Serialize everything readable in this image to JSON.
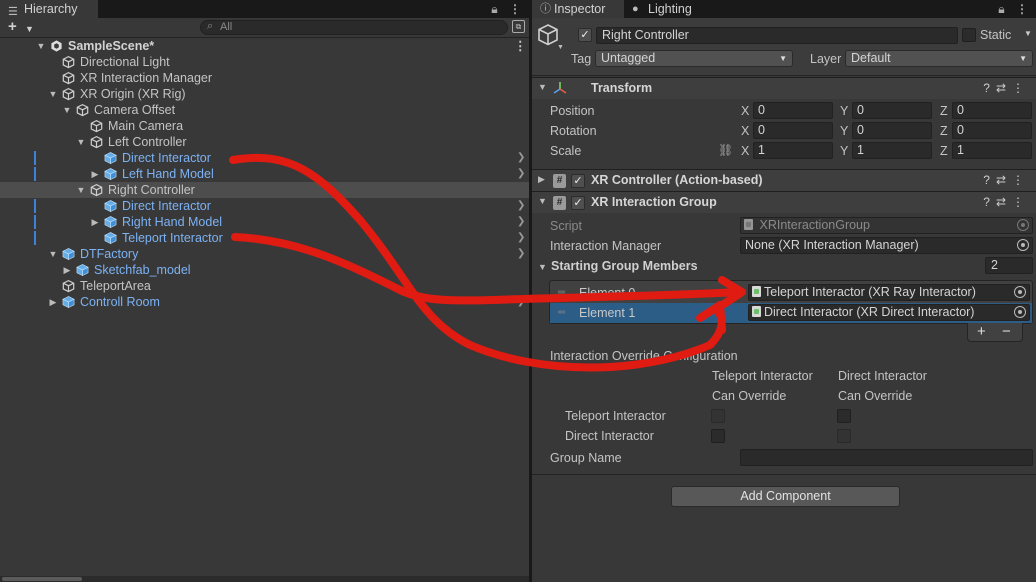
{
  "hierarchy": {
    "tab_label": "Hierarchy",
    "search_placeholder": "All",
    "rows": [
      {
        "label": "SampleScene*",
        "depth": 0,
        "arrow": "down",
        "icon": "unity-logo-icon",
        "style": "scene"
      },
      {
        "label": "Directional Light",
        "depth": 1,
        "arrow": "",
        "icon": "gameobject-icon",
        "style": "normal"
      },
      {
        "label": "XR Interaction Manager",
        "depth": 1,
        "arrow": "",
        "icon": "gameobject-icon",
        "style": "normal"
      },
      {
        "label": "XR Origin (XR Rig)",
        "depth": 1,
        "arrow": "down",
        "icon": "gameobject-icon",
        "style": "normal"
      },
      {
        "label": "Camera Offset",
        "depth": 2,
        "arrow": "down",
        "icon": "gameobject-icon",
        "style": "normal"
      },
      {
        "label": "Main Camera",
        "depth": 3,
        "arrow": "",
        "icon": "gameobject-icon",
        "style": "normal"
      },
      {
        "label": "Left Controller",
        "depth": 3,
        "arrow": "down",
        "icon": "gameobject-icon",
        "style": "normal"
      },
      {
        "label": "Direct Interactor",
        "depth": 4,
        "arrow": "",
        "icon": "prefab-icon",
        "style": "prefab",
        "bar": true,
        "chev": true
      },
      {
        "label": "Left Hand Model",
        "depth": 4,
        "arrow": "right",
        "icon": "prefab-icon",
        "style": "prefab",
        "bar": true,
        "chev": true
      },
      {
        "label": "Right Controller",
        "depth": 3,
        "arrow": "down",
        "icon": "gameobject-icon",
        "style": "normal",
        "selected": true
      },
      {
        "label": "Direct Interactor",
        "depth": 4,
        "arrow": "",
        "icon": "prefab-icon",
        "style": "prefab",
        "bar": true,
        "chev": true
      },
      {
        "label": "Right Hand Model",
        "depth": 4,
        "arrow": "right",
        "icon": "prefab-icon",
        "style": "prefab",
        "bar": true,
        "chev": true
      },
      {
        "label": "Teleport Interactor",
        "depth": 4,
        "arrow": "",
        "icon": "prefab-icon",
        "style": "prefab",
        "bar": true,
        "chev": true
      },
      {
        "label": "DTFactory",
        "depth": 1,
        "arrow": "down",
        "icon": "prefab-icon",
        "style": "prefab",
        "chev": true
      },
      {
        "label": "Sketchfab_model",
        "depth": 2,
        "arrow": "right",
        "icon": "prefab-icon",
        "style": "prefab"
      },
      {
        "label": "TeleportArea",
        "depth": 1,
        "arrow": "",
        "icon": "gameobject-icon",
        "style": "normal"
      },
      {
        "label": "Controll Room",
        "depth": 1,
        "arrow": "right",
        "icon": "prefab-icon",
        "style": "prefab",
        "chev": true
      }
    ]
  },
  "inspector": {
    "tabs": [
      {
        "label": "Inspector",
        "icon": "info-icon"
      },
      {
        "label": "Lighting",
        "icon": "lighting-icon"
      }
    ],
    "object_name": "Right Controller",
    "static_label": "Static",
    "tag_label": "Tag",
    "tag_value": "Untagged",
    "layer_label": "Layer",
    "layer_value": "Default",
    "transform": {
      "title": "Transform",
      "position_label": "Position",
      "rotation_label": "Rotation",
      "scale_label": "Scale",
      "position": {
        "x": "0",
        "y": "0",
        "z": "0"
      },
      "rotation": {
        "x": "0",
        "y": "0",
        "z": "0"
      },
      "scale": {
        "x": "1",
        "y": "1",
        "z": "1"
      },
      "axis_x": "X",
      "axis_y": "Y",
      "axis_z": "Z"
    },
    "xr_controller": {
      "title": "XR Controller (Action-based)"
    },
    "xr_group": {
      "title": "XR Interaction Group",
      "script_label": "Script",
      "script_value": "XRInteractionGroup",
      "manager_label": "Interaction Manager",
      "manager_value": "None (XR Interaction Manager)",
      "members_label": "Starting Group Members",
      "members_count": "2",
      "elements": [
        {
          "label": "Element 0",
          "value": "Teleport Interactor (XR Ray Interactor)"
        },
        {
          "label": "Element 1",
          "value": "Direct Interactor (XR Direct Interactor)"
        }
      ],
      "add_label": "+",
      "remove_label": "−",
      "override_label": "Interaction Override Configuration",
      "col1_line1": "Teleport Interactor",
      "col1_line2": "Can Override",
      "col2_line1": "Direct Interactor",
      "col2_line2": "Can Override",
      "row1_label": "Teleport Interactor",
      "row2_label": "Direct Interactor",
      "group_name_label": "Group Name",
      "group_name_value": ""
    },
    "add_component_label": "Add Component"
  },
  "annotation_color": "#e01b12"
}
